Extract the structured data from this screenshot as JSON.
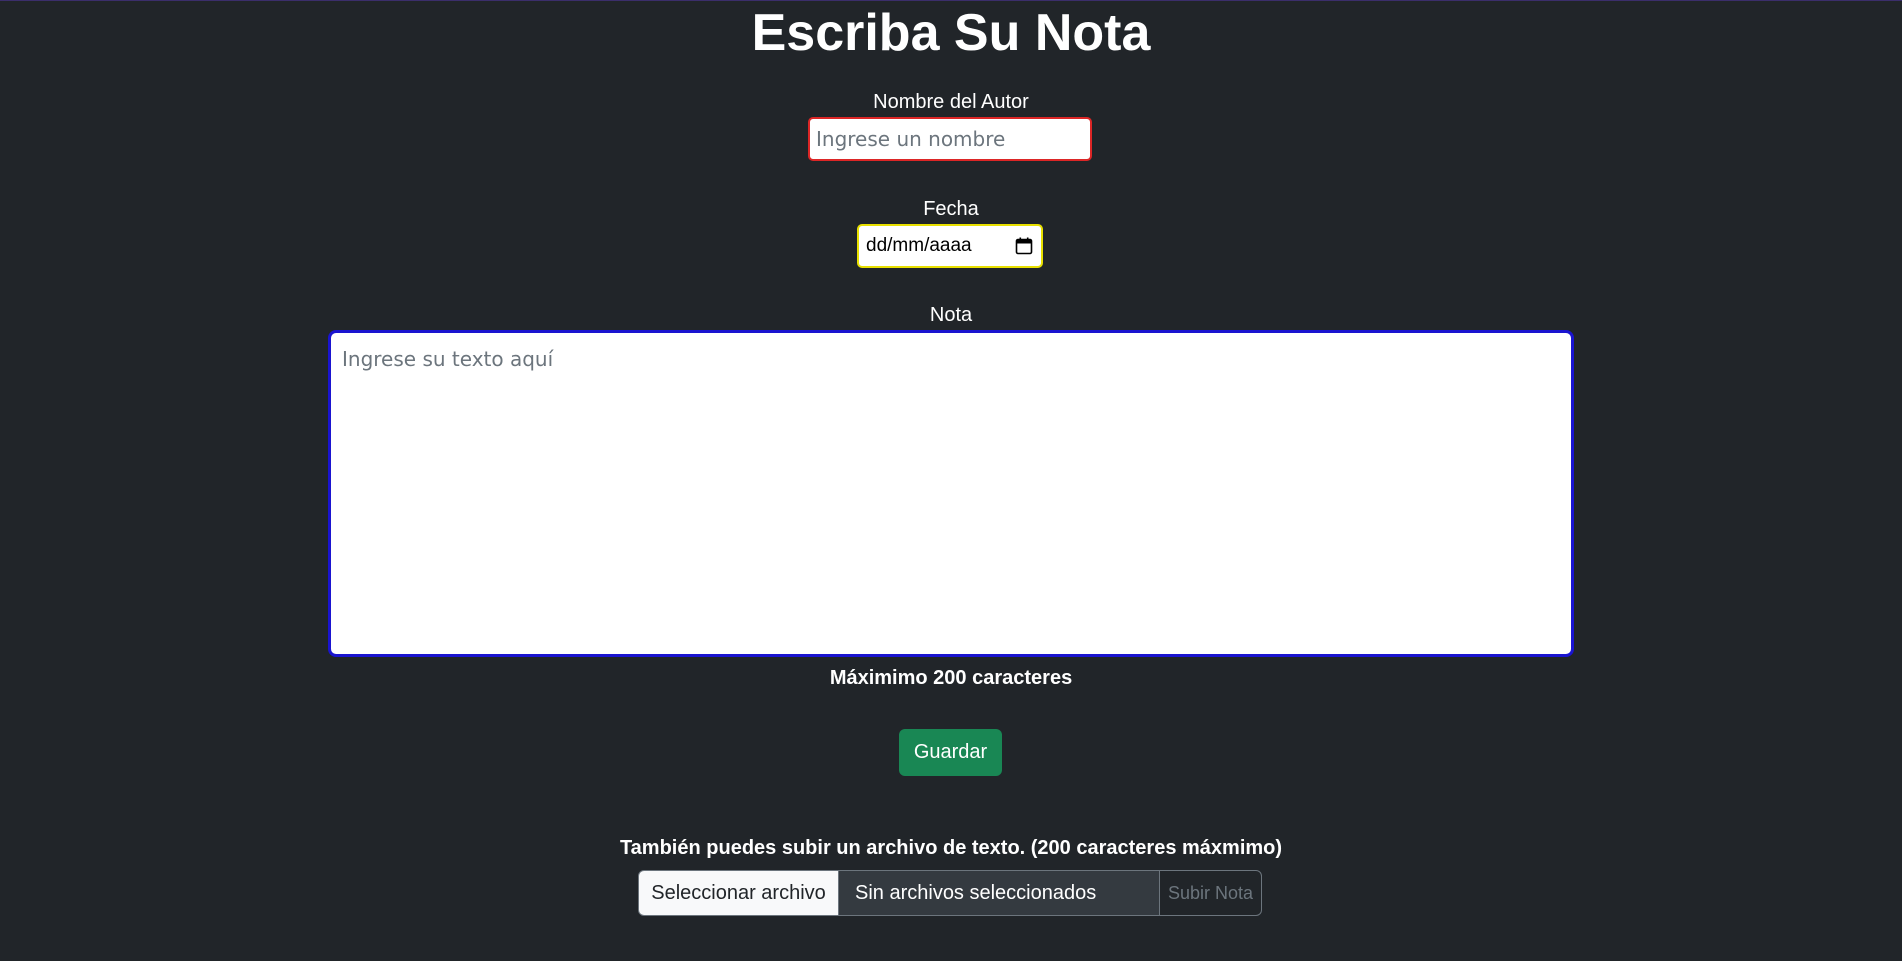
{
  "page": {
    "title": "Escriba Su Nota"
  },
  "author": {
    "label": "Nombre del Autor",
    "placeholder": "Ingrese un nombre",
    "value": ""
  },
  "date": {
    "label": "Fecha",
    "placeholder": "dd/mm/aaaa",
    "icon": "calendar-icon"
  },
  "note": {
    "label": "Nota",
    "placeholder": "Ingrese su texto aquí",
    "value": "",
    "hint": "Máximimo 200 caracteres"
  },
  "actions": {
    "save_label": "Guardar"
  },
  "upload": {
    "label": "También puedes subir un archivo de texto. (200 caracteres máxmimo)",
    "choose_label": "Seleccionar archivo",
    "status": "Sin archivos seleccionados",
    "submit_label": "Subir Nota"
  },
  "colors": {
    "background": "#212529",
    "author_border": "#dc2626",
    "date_border": "#e8e000",
    "note_border": "#1a14d0",
    "save_button": "#198754"
  }
}
